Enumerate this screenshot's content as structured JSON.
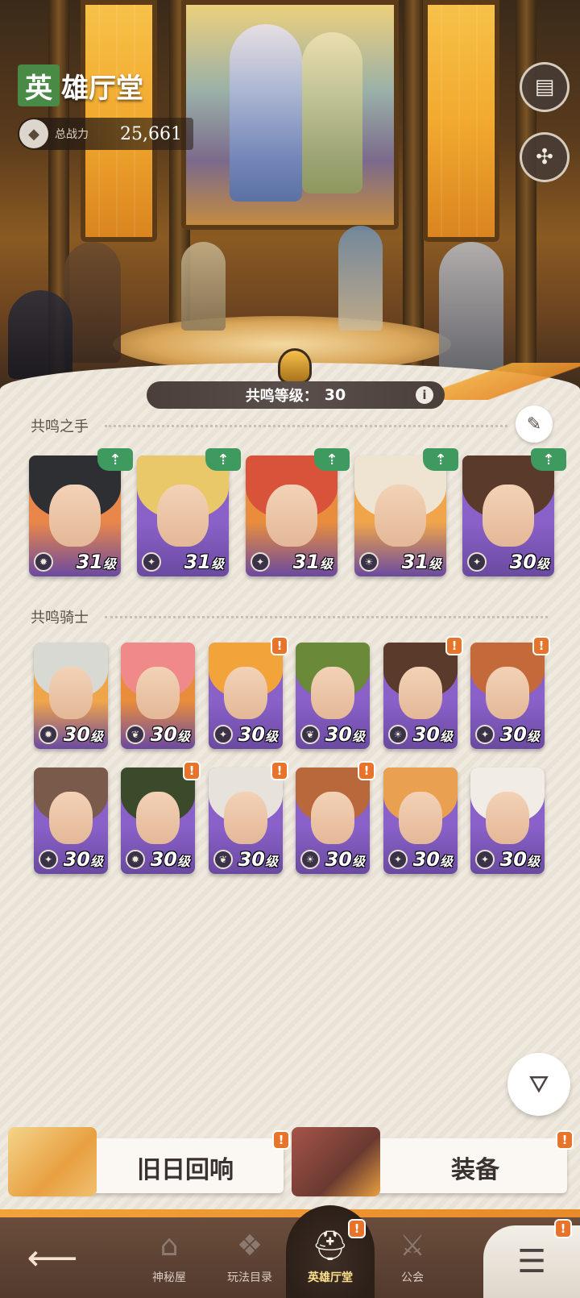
{
  "header": {
    "title_first": "英",
    "title_rest": "雄厅堂",
    "power_label": "总战力",
    "power_value": "25,661"
  },
  "resonance": {
    "label": "共鸣等级：",
    "value": "30",
    "info": "i"
  },
  "sections": {
    "hands": "共鸣之手",
    "knights": "共鸣骑士"
  },
  "hands": [
    {
      "level": "31",
      "unit": "级",
      "up": "⇡",
      "colors": [
        "#e9874a",
        "#2d2f33"
      ],
      "class_icon": "gear-icon"
    },
    {
      "level": "31",
      "unit": "级",
      "up": "⇡",
      "colors": [
        "#8a61c9",
        "#e9c86a"
      ],
      "class_icon": "star-icon"
    },
    {
      "level": "31",
      "unit": "级",
      "up": "⇡",
      "colors": [
        "#e98d3d",
        "#d9533a"
      ],
      "class_icon": "star-icon"
    },
    {
      "level": "31",
      "unit": "级",
      "up": "⇡",
      "colors": [
        "#f0a54a",
        "#efe3d2"
      ],
      "class_icon": "sun-icon"
    },
    {
      "level": "30",
      "unit": "级",
      "up": "⇡",
      "colors": [
        "#8a61c9",
        "#5a3a2a"
      ],
      "class_icon": "star-icon"
    }
  ],
  "knights": [
    {
      "level": "30",
      "unit": "级",
      "alert": false,
      "colors": [
        "#f0a54a",
        "#d9d9d4"
      ],
      "class_icon": "gear-icon"
    },
    {
      "level": "30",
      "unit": "级",
      "alert": false,
      "colors": [
        "#e98d3d",
        "#f08a8a"
      ],
      "class_icon": "leaf-icon"
    },
    {
      "level": "30",
      "unit": "级",
      "alert": true,
      "colors": [
        "#8a61c9",
        "#f2a33a"
      ],
      "class_icon": "star-icon"
    },
    {
      "level": "30",
      "unit": "级",
      "alert": false,
      "colors": [
        "#8a61c9",
        "#6a8a3a"
      ],
      "class_icon": "leaf-icon"
    },
    {
      "level": "30",
      "unit": "级",
      "alert": true,
      "colors": [
        "#8a61c9",
        "#5a3a2a"
      ],
      "class_icon": "sun-icon"
    },
    {
      "level": "30",
      "unit": "级",
      "alert": true,
      "colors": [
        "#8a61c9",
        "#c46a3a"
      ],
      "class_icon": "star-icon"
    },
    {
      "level": "30",
      "unit": "级",
      "alert": false,
      "colors": [
        "#8a61c9",
        "#7a5a4a"
      ],
      "class_icon": "star-icon"
    },
    {
      "level": "30",
      "unit": "级",
      "alert": true,
      "colors": [
        "#8a61c9",
        "#3a4a2a"
      ],
      "class_icon": "gear-icon"
    },
    {
      "level": "30",
      "unit": "级",
      "alert": true,
      "colors": [
        "#8a61c9",
        "#e8e2dc"
      ],
      "class_icon": "leaf-icon"
    },
    {
      "level": "30",
      "unit": "级",
      "alert": true,
      "colors": [
        "#8a61c9",
        "#b8683a"
      ],
      "class_icon": "sun-icon"
    },
    {
      "level": "30",
      "unit": "级",
      "alert": false,
      "colors": [
        "#8a61c9",
        "#e9a050"
      ],
      "class_icon": "star-icon"
    },
    {
      "level": "30",
      "unit": "级",
      "alert": false,
      "colors": [
        "#8a61c9",
        "#f1ece6"
      ],
      "class_icon": "star-icon"
    }
  ],
  "features": {
    "echo_label": "旧日回响",
    "equip_label": "装备",
    "alert": "!"
  },
  "nav": {
    "items": [
      {
        "label": "神秘屋",
        "icon": "mystery-house-icon",
        "glyph": "⌂"
      },
      {
        "label": "玩法目录",
        "icon": "catalog-icon",
        "glyph": "❖"
      },
      {
        "label": "英雄厅堂",
        "icon": "helmet-icon",
        "glyph": "⛑"
      },
      {
        "label": "公会",
        "icon": "guild-icon",
        "glyph": "⚔"
      }
    ],
    "alert": "!"
  },
  "colors": {
    "accent": "#f2a33a",
    "up_green": "#3f9a5f",
    "alert_orange": "#e8732a"
  }
}
